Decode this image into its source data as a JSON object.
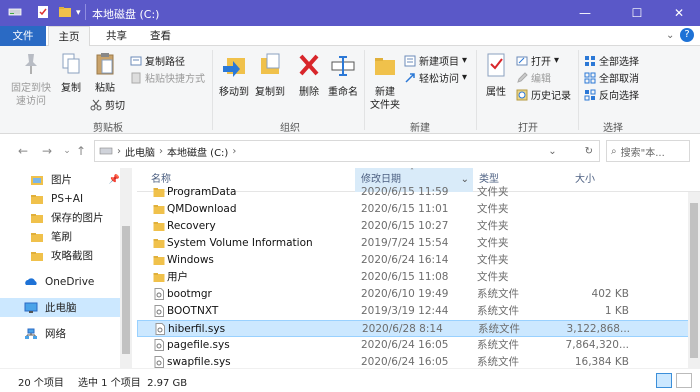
{
  "window": {
    "title": "本地磁盘 (C:)",
    "minimize": "—",
    "maximize": "☐",
    "close": "✕"
  },
  "tabs": {
    "file": "文件",
    "home": "主页",
    "share": "共享",
    "view": "查看"
  },
  "ribbon": {
    "clipboard": {
      "pin": "固定到快\n速访问",
      "copy": "复制",
      "paste": "粘贴",
      "copy_path": "复制路径",
      "paste_shortcut": "粘贴快捷方式",
      "cut": "剪切",
      "label": "剪贴板"
    },
    "organize": {
      "move_to": "移动到",
      "copy_to": "复制到",
      "delete": "删除",
      "rename": "重命名",
      "label": "组织"
    },
    "new": {
      "new_folder": "新建\n文件夹",
      "new_item": "新建项目",
      "easy_access": "轻松访问",
      "label": "新建"
    },
    "open": {
      "properties": "属性",
      "open": "打开",
      "edit": "编辑",
      "history": "历史记录",
      "label": "打开"
    },
    "select": {
      "select_all": "全部选择",
      "select_none": "全部取消",
      "invert": "反向选择",
      "label": "选择"
    }
  },
  "address": {
    "crumb1": "此电脑",
    "crumb2": "本地磁盘 (C:)",
    "search_placeholder": "搜索\"本..."
  },
  "nav": [
    {
      "label": "图片",
      "icon": "pictures-folder-icon"
    },
    {
      "label": "PS+AI",
      "icon": "folder-icon"
    },
    {
      "label": "保存的图片",
      "icon": "folder-icon"
    },
    {
      "label": "笔刷",
      "icon": "folder-icon"
    },
    {
      "label": "攻略截图",
      "icon": "folder-icon"
    },
    {
      "label": "OneDrive",
      "icon": "onedrive-icon"
    },
    {
      "label": "此电脑",
      "icon": "this-pc-icon"
    },
    {
      "label": "网络",
      "icon": "network-icon"
    }
  ],
  "columns": {
    "name": "名称",
    "date": "修改日期",
    "type": "类型",
    "size": "大小"
  },
  "files": [
    {
      "name": "ProgramData",
      "date": "2020/6/15 11:59",
      "type": "文件夹",
      "size": "",
      "kind": "folder"
    },
    {
      "name": "QMDownload",
      "date": "2020/6/15 11:01",
      "type": "文件夹",
      "size": "",
      "kind": "folder"
    },
    {
      "name": "Recovery",
      "date": "2020/6/15 10:27",
      "type": "文件夹",
      "size": "",
      "kind": "folder"
    },
    {
      "name": "System Volume Information",
      "date": "2019/7/24 15:54",
      "type": "文件夹",
      "size": "",
      "kind": "folder"
    },
    {
      "name": "Windows",
      "date": "2020/6/24 16:14",
      "type": "文件夹",
      "size": "",
      "kind": "folder"
    },
    {
      "name": "用户",
      "date": "2020/6/15 11:08",
      "type": "文件夹",
      "size": "",
      "kind": "folder"
    },
    {
      "name": "bootmgr",
      "date": "2020/6/10 19:49",
      "type": "系统文件",
      "size": "402 KB",
      "kind": "file"
    },
    {
      "name": "BOOTNXT",
      "date": "2019/3/19 12:44",
      "type": "系统文件",
      "size": "1 KB",
      "kind": "file"
    },
    {
      "name": "hiberfil.sys",
      "date": "2020/6/28 8:14",
      "type": "系统文件",
      "size": "3,122,868...",
      "kind": "file",
      "selected": true
    },
    {
      "name": "pagefile.sys",
      "date": "2020/6/24 16:05",
      "type": "系统文件",
      "size": "7,864,320...",
      "kind": "file"
    },
    {
      "name": "swapfile.sys",
      "date": "2020/6/24 16:05",
      "type": "系统文件",
      "size": "16,384 KB",
      "kind": "file"
    }
  ],
  "status": {
    "count": "20 个项目",
    "selected": "选中 1 个项目  2.97 GB"
  },
  "colors": {
    "titlebar": "#5a58c8",
    "file_tab": "#2a6ac4",
    "folder": "#f0c14b",
    "selection": "#cce8ff"
  }
}
